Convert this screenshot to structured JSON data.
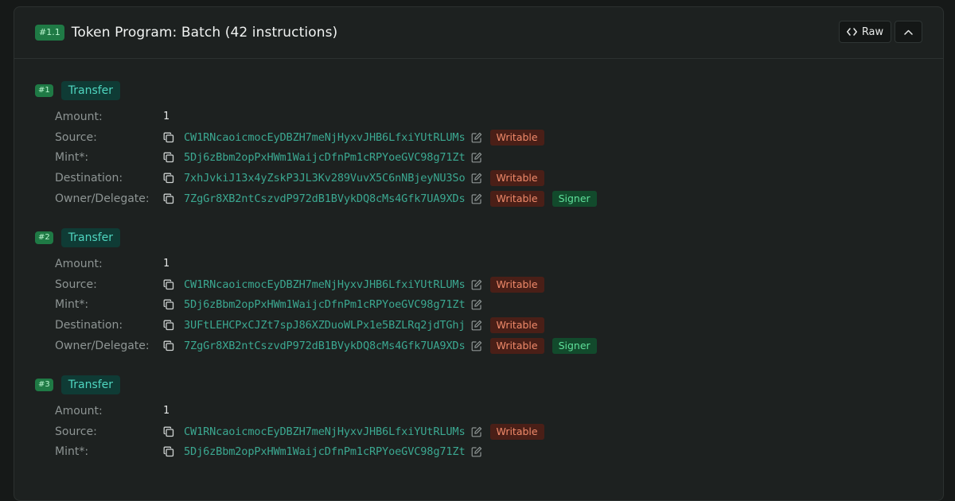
{
  "header": {
    "badge": "#1.1",
    "title": "Token Program: Batch (42 instructions)",
    "raw_label": "Raw"
  },
  "labels": {
    "amount": "Amount:",
    "source": "Source:",
    "mint": "Mint*:",
    "destination": "Destination:",
    "owner": "Owner/Delegate:",
    "writable": "Writable",
    "signer": "Signer"
  },
  "instructions": [
    {
      "num": "#1",
      "name": "Transfer",
      "amount": "1",
      "source": "CW1RNcaoicmocEyDBZH7meNjHyxvJHB6LfxiYUtRLUMs",
      "mint": "5Dj6zBbm2opPxHWm1WaijcDfnPm1cRPYoeGVC98g71Zt",
      "destination": "7xhJvkiJ13x4yZskP3JL3Kv289VuvX5C6nNBjeyNU3So",
      "owner": "7ZgGr8XB2ntCszvdP972dB1BVykDQ8cMs4Gfk7UA9XDs"
    },
    {
      "num": "#2",
      "name": "Transfer",
      "amount": "1",
      "source": "CW1RNcaoicmocEyDBZH7meNjHyxvJHB6LfxiYUtRLUMs",
      "mint": "5Dj6zBbm2opPxHWm1WaijcDfnPm1cRPYoeGVC98g71Zt",
      "destination": "3UFtLEHCPxCJZt7spJ86XZDuoWLPx1e5BZLRq2jdTGhj",
      "owner": "7ZgGr8XB2ntCszvdP972dB1BVykDQ8cMs4Gfk7UA9XDs"
    },
    {
      "num": "#3",
      "name": "Transfer",
      "amount": "1",
      "source": "CW1RNcaoicmocEyDBZH7meNjHyxvJHB6LfxiYUtRLUMs",
      "mint": "5Dj6zBbm2opPxHWm1WaijcDfnPm1cRPYoeGVC98g71Zt"
    }
  ]
}
